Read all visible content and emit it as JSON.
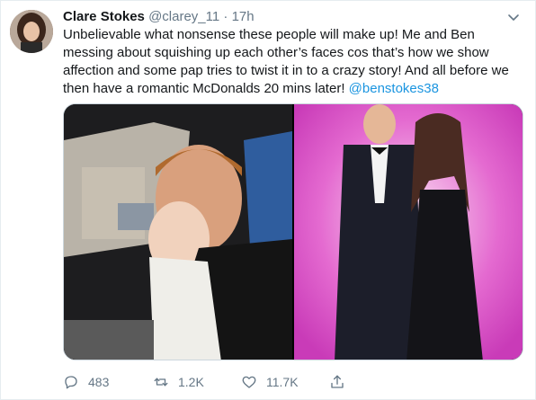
{
  "tweet": {
    "author_name": "Clare Stokes",
    "handle": "@clarey_11",
    "separator": " · ",
    "time": "17h",
    "text": "Unbelievable what nonsense these people will make up! Me and Ben messing about squishing up each other’s faces cos that’s how we show affection and some pap tries to twist it in to a crazy story! And all before we then have a romantic McDonalds 20 mins later! ",
    "mention": "@benstokes38",
    "media": {
      "left_alt": "photo-in-car",
      "right_alt": "photo-at-pca-awards"
    },
    "actions": {
      "reply_count": "483",
      "retweet_count": "1.2K",
      "like_count": "11.7K"
    }
  },
  "colors": {
    "link": "#1b95e0",
    "meta": "#657786",
    "text": "#14171a",
    "border": "#e6ecf0"
  },
  "icons": {
    "caret": "chevron-down-icon",
    "reply": "reply-icon",
    "retweet": "retweet-icon",
    "like": "heart-icon",
    "share": "share-icon"
  }
}
